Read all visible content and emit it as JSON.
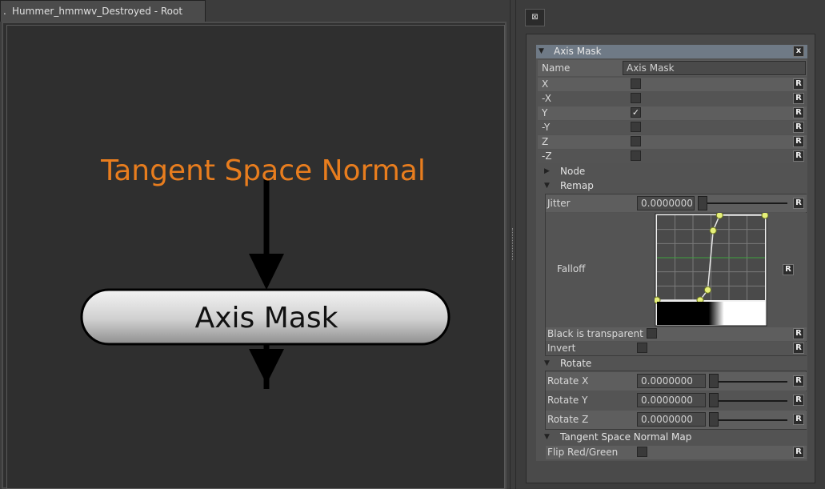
{
  "graph": {
    "tab_title": "Hummer_hmmwv_Destroyed - Root",
    "input_label": "Tangent Space Normal",
    "node_label": "Axis Mask",
    "accent_color": "#e87d1e"
  },
  "panel": {
    "close_glyph": "⊠",
    "section_title": "Axis Mask",
    "section_close": "x",
    "name_label": "Name",
    "name_value": "Axis Mask",
    "reset_label": "R",
    "axes": [
      {
        "label": "X",
        "checked": false
      },
      {
        "label": "-X",
        "checked": false
      },
      {
        "label": "Y",
        "checked": true
      },
      {
        "label": "-Y",
        "checked": false
      },
      {
        "label": "Z",
        "checked": false
      },
      {
        "label": "-Z",
        "checked": false
      }
    ],
    "node_group": "Node",
    "remap_group": "Remap",
    "jitter_label": "Jitter",
    "jitter_value": "0.0000000",
    "falloff_label": "Falloff",
    "black_transparent_label": "Black is transparent",
    "invert_label": "Invert",
    "rotate_group": "Rotate",
    "rotate": [
      {
        "label": "Rotate X",
        "value": "0.0000000"
      },
      {
        "label": "Rotate Y",
        "value": "0.0000000"
      },
      {
        "label": "Rotate Z",
        "value": "0.0000000"
      }
    ],
    "tsn_group": "Tangent Space Normal Map",
    "flip_label": "Flip Red/Green",
    "check_glyph": "✓"
  },
  "falloff_curve": {
    "points": [
      [
        0,
        0
      ],
      [
        0.4,
        0
      ],
      [
        0.47,
        0.12
      ],
      [
        0.52,
        0.82
      ],
      [
        0.58,
        1.0
      ],
      [
        1.0,
        1.0
      ]
    ]
  }
}
